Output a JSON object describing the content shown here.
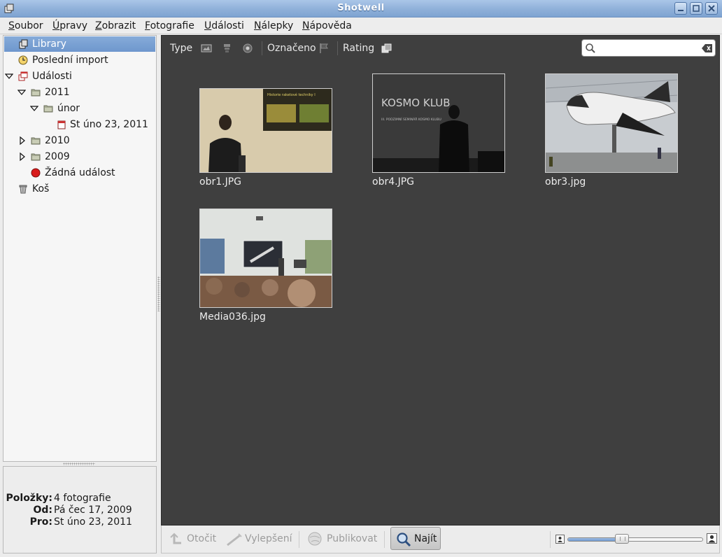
{
  "window": {
    "title": "Shotwell"
  },
  "menu": [
    {
      "label": "Soubor"
    },
    {
      "label": "Úpravy"
    },
    {
      "label": "Zobrazit"
    },
    {
      "label": "Fotografie"
    },
    {
      "label": "Události"
    },
    {
      "label": "Nálepky"
    },
    {
      "label": "Nápověda"
    }
  ],
  "sidebar": {
    "items": [
      {
        "label": "Library",
        "icon": "library-icon",
        "selected": true
      },
      {
        "label": "Poslední import",
        "icon": "clock-icon"
      },
      {
        "label": "Události",
        "icon": "events-icon",
        "expanded": true
      },
      {
        "label": "2011",
        "icon": "folder-icon",
        "expanded": true
      },
      {
        "label": "únor",
        "icon": "folder-icon",
        "expanded": true
      },
      {
        "label": "St úno 23, 2011",
        "icon": "calendar-icon"
      },
      {
        "label": "2010",
        "icon": "folder-icon",
        "expanded": false
      },
      {
        "label": "2009",
        "icon": "folder-icon",
        "expanded": false
      },
      {
        "label": "Žádná událost",
        "icon": "no-event-icon"
      },
      {
        "label": "Koš",
        "icon": "trash-icon"
      }
    ]
  },
  "info": {
    "items_label": "Položky:",
    "items_value": "4 fotografie",
    "from_label": "Od:",
    "from_value": "Pá čec 17, 2009",
    "to_label": "Pro:",
    "to_value": "St úno 23, 2011"
  },
  "toolbar": {
    "type_label": "Type",
    "flagged_label": "Označeno",
    "rating_label": "Rating",
    "search_value": "",
    "search_placeholder": ""
  },
  "photos": [
    {
      "filename": "obr1.JPG"
    },
    {
      "filename": "obr4.JPG",
      "caption_title": "KOSMO KLUB",
      "caption_sub": "III. PODZIMNÍ SEMINÁŘ KOSMO KLUBU"
    },
    {
      "filename": "obr3.jpg"
    },
    {
      "filename": "Media036.jpg"
    }
  ],
  "photo1_slide_title": "Historie raketové techniky I",
  "bottombar": {
    "rotate_label": "Otočit",
    "enhance_label": "Vylepšení",
    "publish_label": "Publikovat",
    "find_label": "Najít",
    "zoom_level": 0.39
  },
  "colors": {
    "selection": "#7aa1d3",
    "viewer_bg": "#3f3f3f",
    "title_bar": "#8fb0d9"
  }
}
